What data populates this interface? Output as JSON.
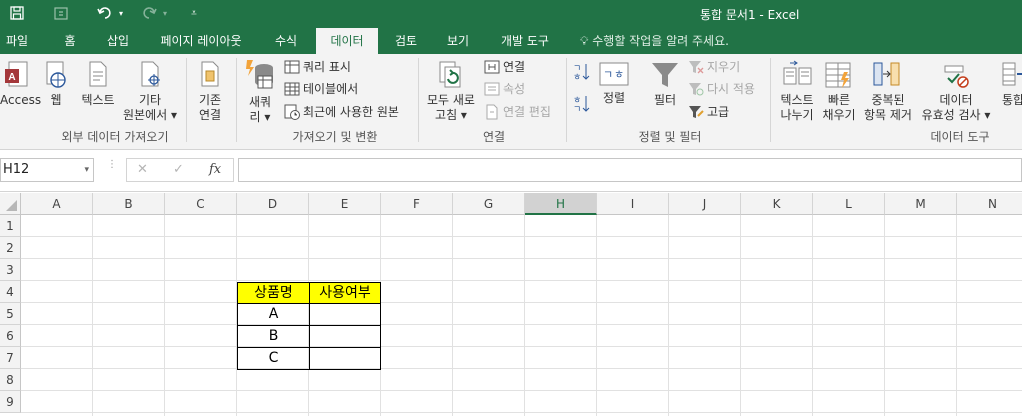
{
  "window": {
    "title": "통합 문서1 - Excel"
  },
  "quick_access": {
    "save_icon": "save-icon",
    "autosave_icon": "touch-icon",
    "undo_icon": "undo-icon",
    "redo_icon": "redo-icon",
    "customize_icon": "customize-icon"
  },
  "tabs": [
    "파일",
    "홈",
    "삽입",
    "페이지 레이아웃",
    "수식",
    "데이터",
    "검토",
    "보기",
    "개발 도구"
  ],
  "active_tab": "데이터",
  "tell_me": "수행할 작업을 알려 주세요.",
  "ribbon": {
    "get_external": {
      "group_label": "외부 데이터 가져오기",
      "access": "Access",
      "web": "웹",
      "text": "텍스트",
      "other_line1": "기타",
      "other_line2": "원본에서 ▾",
      "existing_line1": "기존",
      "existing_line2": "연결"
    },
    "get_transform": {
      "group_label": "가져오기 및 변환",
      "new_query_line1": "새쿼",
      "new_query_line2": "리 ▾",
      "show_queries": "쿼리 표시",
      "from_table": "테이블에서",
      "recent_sources": "최근에 사용한 원본"
    },
    "connections": {
      "group_label": "연결",
      "refresh_line1": "모두 새로",
      "refresh_line2": "고침 ▾",
      "connections": "연결",
      "properties": "속성",
      "edit_links": "연결 편집"
    },
    "sort_filter": {
      "group_label": "정렬 및 필터",
      "sort": "정렬",
      "filter": "필터",
      "clear": "지우기",
      "reapply": "다시 적용",
      "advanced": "고급"
    },
    "data_tools": {
      "group_label": "데이터 도구",
      "text_to_columns_line1": "텍스트",
      "text_to_columns_line2": "나누기",
      "flash_fill_line1": "빠른",
      "flash_fill_line2": "채우기",
      "remove_dup_line1": "중복된",
      "remove_dup_line2": "항목 제거",
      "validation_line1": "데이터",
      "validation_line2": "유효성 검사 ▾",
      "consolidate": "통합"
    }
  },
  "formula_bar": {
    "name_box": "H12",
    "cancel": "✕",
    "enter": "✓",
    "fx": "fx",
    "formula": ""
  },
  "columns": [
    "A",
    "B",
    "C",
    "D",
    "E",
    "F",
    "G",
    "H",
    "I",
    "J",
    "K",
    "L",
    "M",
    "N"
  ],
  "selected_column": "H",
  "rows": [
    "1",
    "2",
    "3",
    "4",
    "5",
    "6",
    "7",
    "8",
    "9"
  ],
  "table": {
    "header": [
      "상품명",
      "사용여부"
    ],
    "rows": [
      [
        "A",
        ""
      ],
      [
        "B",
        ""
      ],
      [
        "C",
        ""
      ]
    ],
    "header_fill": "#ffff00"
  },
  "colors": {
    "brand": "#217346"
  }
}
